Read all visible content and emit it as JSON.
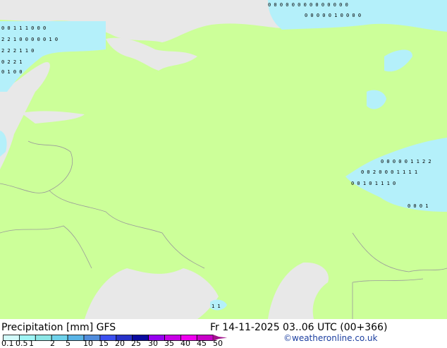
{
  "title": "Precipitation [mm]",
  "model": "GFS",
  "datetime": "Fr 14-11-2025 03..06 UTC (00+366)",
  "credit": "©weatheronline.co.uk",
  "colors": {
    "land": "#ccff99",
    "sea": "#e8e8e8",
    "precip": "#b4f0fa",
    "precip2": "#8ce6f0",
    "border": "#a0a0a0"
  },
  "legend": {
    "ticks": [
      "0.1",
      "0.5",
      "1",
      "2",
      "5",
      "10",
      "15",
      "20",
      "25",
      "30",
      "35",
      "40",
      "45",
      "50"
    ],
    "colors": [
      "#d2fafa",
      "#a0f5f5",
      "#8ce6e6",
      "#6ed2eb",
      "#5ab4e6",
      "#508cdc",
      "#3c50f0",
      "#2832c8",
      "#0a0aa0",
      "#9600f0",
      "#c800e6",
      "#f000f0",
      "#c800c8"
    ],
    "arrow_color": "#a0148c"
  },
  "precip_labels": [
    {
      "lon": "nw",
      "text": "0 0 1 1 1 0 0 0"
    },
    {
      "lon": "nw",
      "text": "2 2 1 0 0 0 0 0 1 0"
    },
    {
      "lon": "nw",
      "text": "2 2 2 1 1 0"
    },
    {
      "lon": "nw",
      "text": "0 2 2 1"
    },
    {
      "lon": "nw",
      "text": "0 1 0 0"
    },
    {
      "lon": "ne",
      "text": "0 0 0 0 0 0 0 0 0 0 0 0 0 0"
    },
    {
      "lon": "ne",
      "text": "0 0 0 0 0 1 0 0 0 0"
    },
    {
      "lon": "e",
      "text": "0 0 0 0 0 1 1 2 2"
    },
    {
      "lon": "e",
      "text": "0 0 2 0 0 0 1 1 1 1"
    },
    {
      "lon": "e",
      "text": "0 0 1 0 1 1 1 0"
    },
    {
      "lon": "e",
      "text": "0 0 0 1"
    },
    {
      "lon": "s",
      "text": "1 1"
    }
  ]
}
